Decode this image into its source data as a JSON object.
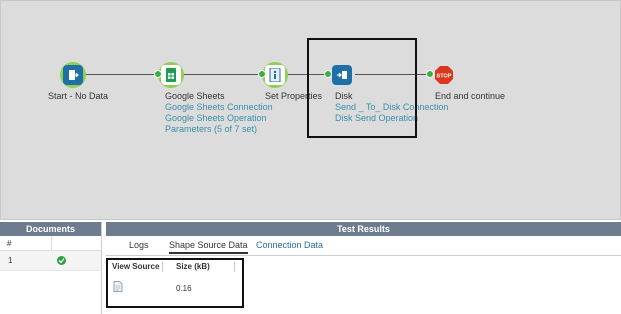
{
  "process": {
    "start": {
      "label": "Start - No Data"
    },
    "google_sheets": {
      "label": "Google Sheets",
      "connection": "Google Sheets Connection",
      "operation": "Google Sheets Operation",
      "parameters": "Parameters (5 of 7 set)"
    },
    "set_properties": {
      "label": "Set Properties"
    },
    "disk": {
      "label": "Disk",
      "connection": "Send _ To_ Disk Connection",
      "operation": "Disk Send Operation"
    },
    "stop": {
      "label": "End and continue",
      "icon_text": "STOP"
    }
  },
  "documents": {
    "title": "Documents",
    "col_number": "#",
    "rows": [
      {
        "number": "1",
        "status_icon": "check-circle-icon"
      }
    ]
  },
  "test_results": {
    "title": "Test Results",
    "tabs": [
      "Logs",
      "Shape Source Data",
      "Connection Data"
    ],
    "active_tab": "Shape Source Data",
    "columns": {
      "view_source": "View Source",
      "size": "Size (kB)"
    },
    "rows": [
      {
        "size": "0.16",
        "icon": "document-icon"
      }
    ]
  },
  "colors": {
    "canvas_bg": "#dcdcdc",
    "panel_header": "#6f7c8f",
    "shape_blue": "#1f6fa8",
    "halo_green": "#8fd14f",
    "link": "#3a8fa8",
    "stop_red": "#d9381e"
  }
}
